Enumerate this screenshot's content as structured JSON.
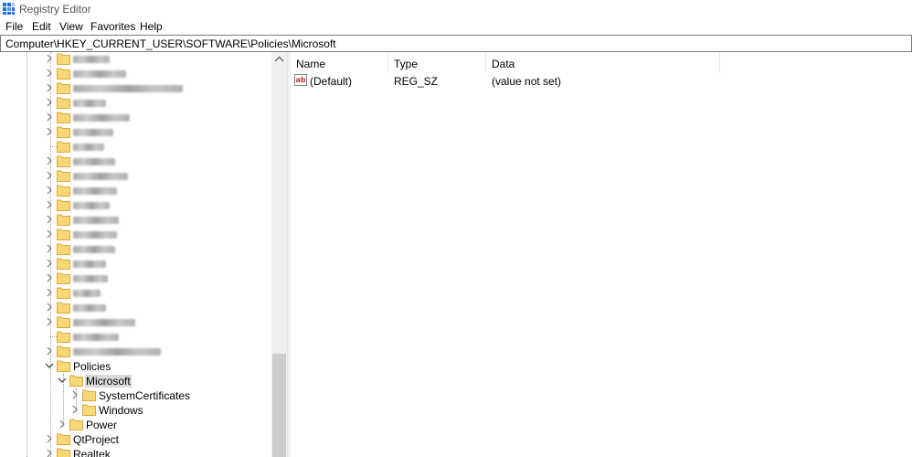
{
  "window": {
    "title": "Registry Editor"
  },
  "menu": [
    "File",
    "Edit",
    "View",
    "Favorites",
    "Help"
  ],
  "address": {
    "path": "Computer\\HKEY_CURRENT_USER\\SOFTWARE\\Policies\\Microsoft"
  },
  "tree": {
    "blurred_count": 21,
    "policies": "Policies",
    "microsoft": "Microsoft",
    "system_certificates": "SystemCertificates",
    "windows": "Windows",
    "power": "Power",
    "qtproject": "QtProject",
    "realtek": "Realtek"
  },
  "columns": {
    "name": "Name",
    "type": "Type",
    "data": "Data"
  },
  "values": [
    {
      "name": "(Default)",
      "type": "REG_SZ",
      "data": "(value not set)",
      "icon": "reg-string-icon"
    }
  ],
  "colors": {
    "folder": "#f8d775",
    "folder_edge": "#d9ab3c",
    "selection": "#d9d9d9"
  }
}
